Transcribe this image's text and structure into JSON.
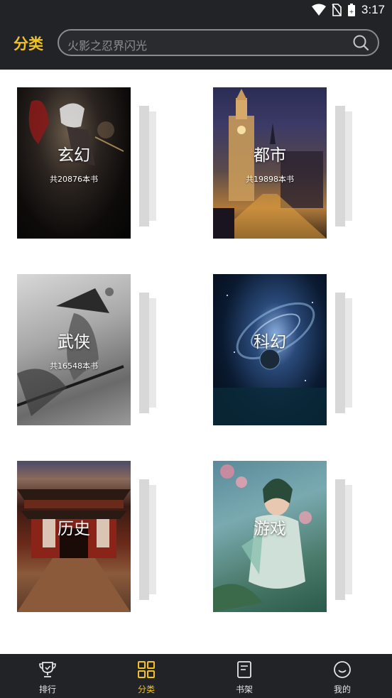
{
  "status_bar": {
    "time": "3:17"
  },
  "header": {
    "title": "分类",
    "search_placeholder": "火影之忍界闪光"
  },
  "categories": [
    {
      "name": "玄幻",
      "count": "共20876本书",
      "theme": "dark-anime"
    },
    {
      "name": "都市",
      "count": "共19898本书",
      "theme": "city-night"
    },
    {
      "name": "武侠",
      "count": "共16548本书",
      "theme": "ink-swordsman"
    },
    {
      "name": "科幻",
      "count": "",
      "theme": "galaxy"
    },
    {
      "name": "历史",
      "count": "",
      "theme": "temple"
    },
    {
      "name": "游戏",
      "count": "",
      "theme": "fantasy-girl"
    }
  ],
  "tabs": [
    {
      "label": "排行",
      "icon": "trophy-icon"
    },
    {
      "label": "分类",
      "icon": "grid-icon",
      "active": true
    },
    {
      "label": "书架",
      "icon": "book-icon"
    },
    {
      "label": "我的",
      "icon": "smile-icon"
    }
  ],
  "colors": {
    "accent": "#f4c21c",
    "bar": "#222326"
  }
}
